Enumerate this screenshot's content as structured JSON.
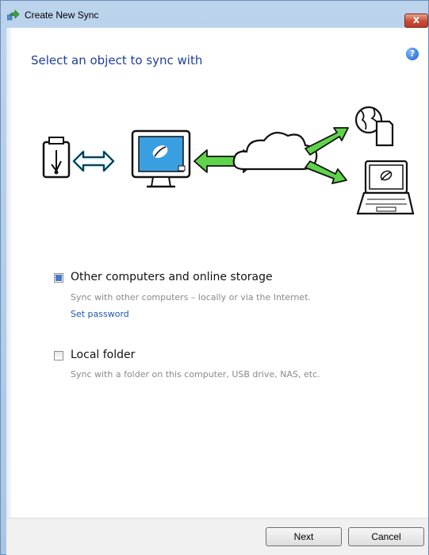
{
  "window": {
    "title": "Create New Sync",
    "close_label": "x"
  },
  "main": {
    "heading": "Select an object to sync with",
    "help_icon_label": "?"
  },
  "options": [
    {
      "title": "Other computers and online storage",
      "description": "Sync with other computers – locally or via the Internet.",
      "link": "Set password",
      "checked": true
    },
    {
      "title": "Local folder",
      "description": "Sync with a folder on this computer, USB drive, NAS, etc.",
      "checked": false
    }
  ],
  "footer": {
    "next_label": "Next",
    "cancel_label": "Cancel"
  },
  "colors": {
    "accent_green": "#5fd44a",
    "arrow_blue": "#3cc2ef",
    "heading_blue": "#1e3f9a",
    "link_blue": "#1a56b5"
  },
  "icons": [
    "sync-app-icon",
    "close-icon",
    "help-icon",
    "usb-drive-icon",
    "computer-icon",
    "cloud-icon",
    "globe-folder-icon",
    "laptop-icon"
  ]
}
